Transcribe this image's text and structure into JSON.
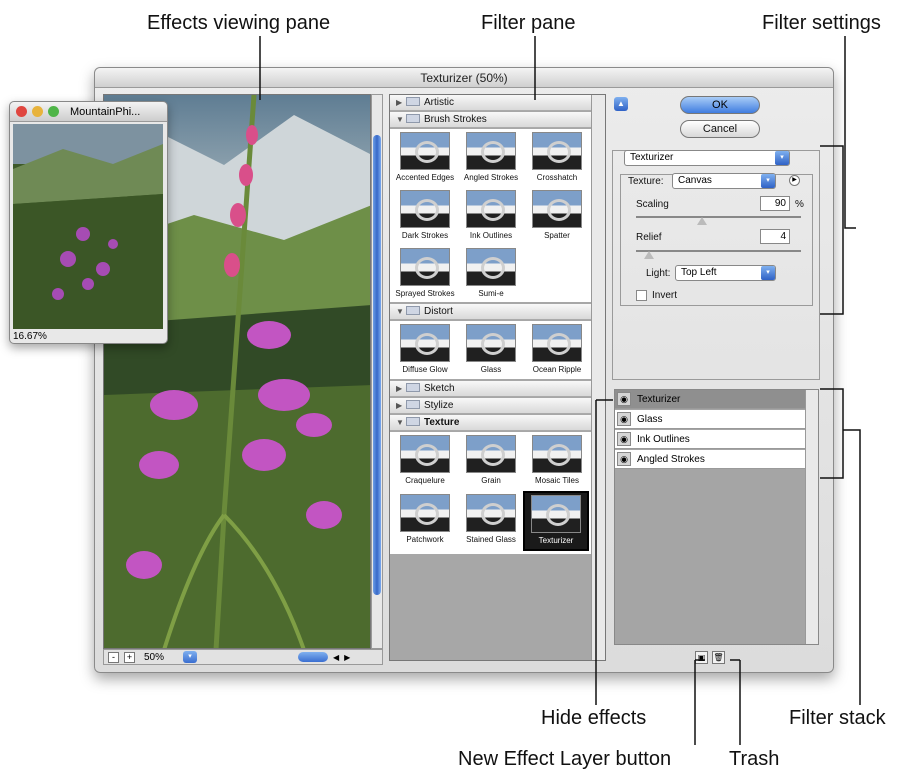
{
  "callouts": {
    "effects_pane": "Effects viewing pane",
    "filter_pane": "Filter pane",
    "filter_settings": "Filter settings",
    "hide_effects": "Hide effects",
    "filter_stack": "Filter stack",
    "new_layer": "New Effect Layer button",
    "trash": "Trash"
  },
  "dialog": {
    "title": "Texturizer (50%)",
    "ok": "OK",
    "cancel": "Cancel"
  },
  "preview": {
    "zoom": "50%",
    "minus": "-",
    "plus": "+"
  },
  "navigator": {
    "title": "MountainPhi...",
    "zoom": "16.67%"
  },
  "categories": {
    "artistic": "Artistic",
    "brush_strokes": "Brush Strokes",
    "distort": "Distort",
    "sketch": "Sketch",
    "stylize": "Stylize",
    "texture": "Texture"
  },
  "brush_strokes": [
    "Accented Edges",
    "Angled Strokes",
    "Crosshatch",
    "Dark Strokes",
    "Ink Outlines",
    "Spatter",
    "Sprayed Strokes",
    "Sumi-e"
  ],
  "distort": [
    "Diffuse Glow",
    "Glass",
    "Ocean Ripple"
  ],
  "texture": [
    "Craquelure",
    "Grain",
    "Mosaic Tiles",
    "Patchwork",
    "Stained Glass",
    "Texturizer"
  ],
  "settings": {
    "filter": "Texturizer",
    "texture_label": "Texture:",
    "texture_value": "Canvas",
    "scaling_label": "Scaling",
    "scaling_value": "90",
    "scaling_unit": "%",
    "relief_label": "Relief",
    "relief_value": "4",
    "light_label": "Light:",
    "light_value": "Top Left",
    "invert_label": "Invert"
  },
  "slider_levels": {
    "scaling_fraction": 0.4,
    "relief_fraction": 0.08
  },
  "layers": [
    "Texturizer",
    "Glass",
    "Ink Outlines",
    "Angled Strokes"
  ],
  "colors": {
    "accent": "#3a6ed0",
    "stack_bg": "#a5a5a5",
    "pane_bg": "#a7a7a7"
  },
  "icons": {
    "eye": "eye-icon",
    "new_layer": "new-layer-icon",
    "trash": "trash-icon"
  }
}
